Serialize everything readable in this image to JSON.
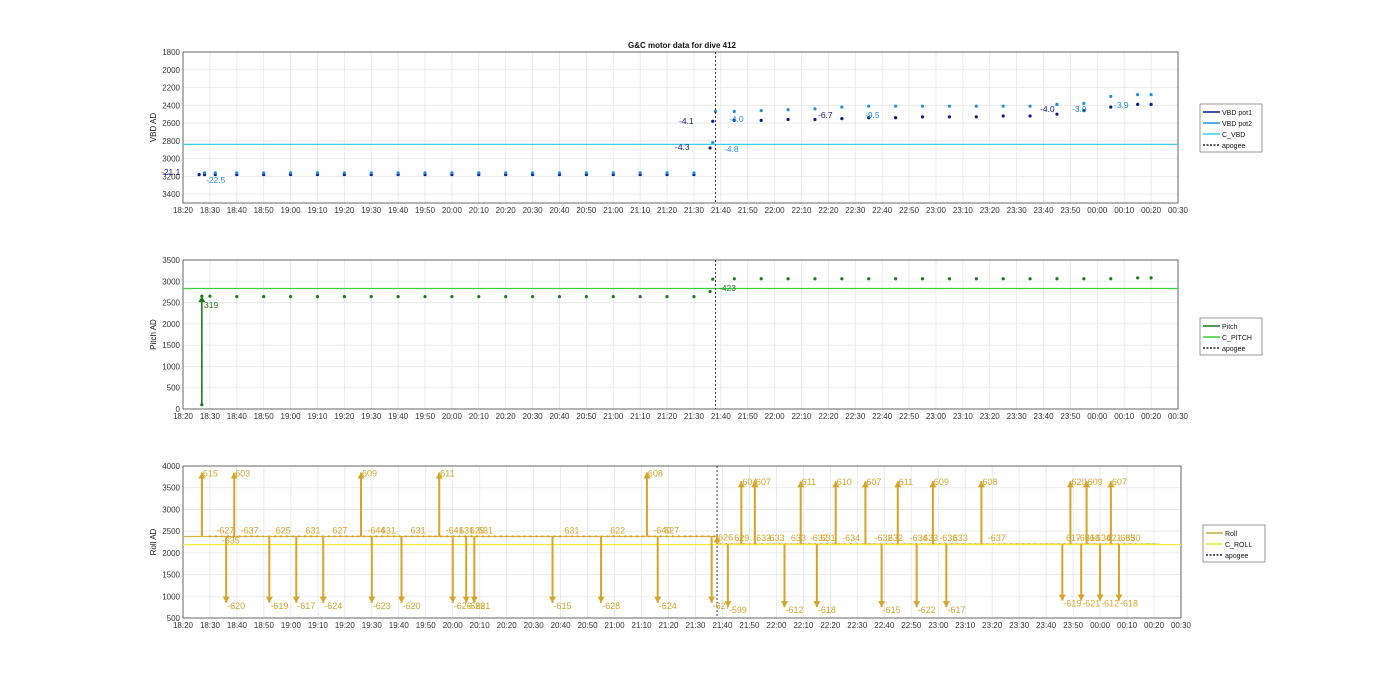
{
  "figure": {
    "title": "G&C motor data for dive 412"
  },
  "time_ticks": [
    "18:20",
    "18:30",
    "18:40",
    "18:50",
    "19:00",
    "19:10",
    "19:20",
    "19:30",
    "19:40",
    "19:50",
    "20:00",
    "20:10",
    "20:20",
    "20:30",
    "20:40",
    "20:50",
    "21:00",
    "21:10",
    "21:20",
    "21:30",
    "21:40",
    "21:50",
    "22:00",
    "22:10",
    "22:20",
    "22:30",
    "22:40",
    "22:50",
    "23:00",
    "23:10",
    "23:20",
    "23:30",
    "23:40",
    "23:50",
    "00:00",
    "00:10",
    "00:20",
    "00:30"
  ],
  "chart_data": [
    {
      "type": "line",
      "ylabel": "VBD AD",
      "ylim": [
        1800,
        3500
      ],
      "y_reversed": true,
      "yticks": [
        "1800",
        "2000",
        "2200",
        "2400",
        "2600",
        "2800",
        "3000",
        "3200",
        "3400"
      ],
      "grid": true,
      "legend_position": "outside-right",
      "series": [
        {
          "name": "VBD pot1",
          "color": "#0a1a8c",
          "x": [
            "18:26",
            "18:28",
            "18:32",
            "18:40",
            "18:50",
            "19:00",
            "19:10",
            "19:20",
            "19:30",
            "19:40",
            "19:50",
            "20:00",
            "20:10",
            "20:20",
            "20:30",
            "20:40",
            "20:50",
            "21:00",
            "21:10",
            "21:20",
            "21:30",
            "21:36",
            "21:37",
            "21:45",
            "21:55",
            "22:05",
            "22:15",
            "22:25",
            "22:35",
            "22:45",
            "22:55",
            "23:05",
            "23:15",
            "23:25",
            "23:35",
            "23:45",
            "23:55",
            "00:05",
            "00:15",
            "00:20"
          ],
          "values": [
            3180,
            3180,
            3180,
            3180,
            3180,
            3180,
            3180,
            3180,
            3180,
            3180,
            3180,
            3180,
            3180,
            3180,
            3180,
            3180,
            3180,
            3180,
            3180,
            3180,
            3180,
            2880,
            2580,
            2570,
            2570,
            2560,
            2560,
            2550,
            2540,
            2540,
            2530,
            2530,
            2530,
            2520,
            2520,
            2500,
            2460,
            2420,
            2390,
            2390
          ]
        },
        {
          "name": "VBD pot2",
          "color": "#1e90e0",
          "x": [
            "18:28",
            "18:32",
            "18:40",
            "18:50",
            "19:00",
            "19:10",
            "19:20",
            "19:30",
            "19:40",
            "19:50",
            "20:00",
            "20:10",
            "20:20",
            "20:30",
            "20:40",
            "20:50",
            "21:00",
            "21:10",
            "21:20",
            "21:30",
            "21:37",
            "21:38",
            "21:45",
            "21:55",
            "22:05",
            "22:15",
            "22:25",
            "22:35",
            "22:45",
            "22:55",
            "23:05",
            "23:15",
            "23:25",
            "23:35",
            "23:45",
            "23:55",
            "00:05",
            "00:15",
            "00:20"
          ],
          "values": [
            3160,
            3160,
            3160,
            3160,
            3160,
            3160,
            3160,
            3160,
            3160,
            3160,
            3160,
            3160,
            3160,
            3160,
            3160,
            3160,
            3160,
            3160,
            3160,
            3160,
            2820,
            2470,
            2470,
            2460,
            2450,
            2440,
            2420,
            2410,
            2410,
            2410,
            2410,
            2410,
            2410,
            2410,
            2390,
            2380,
            2300,
            2280,
            2280
          ]
        },
        {
          "name": "C_VBD",
          "color": "#3ad0e8",
          "x": [
            "18:20",
            "00:30"
          ],
          "values": [
            2840,
            2840
          ]
        },
        {
          "name": "apogee",
          "color": "#222222",
          "dashed": true,
          "x_value": "21:38"
        }
      ],
      "annotations": [
        "-21.1",
        "-22.5",
        "-4.3",
        "-4.8",
        "-4.1",
        "-4.0",
        "-6.7",
        "-9.5",
        "-4.0",
        "-3.9",
        "-3.9"
      ]
    },
    {
      "type": "line",
      "ylabel": "Pitch AD",
      "ylim": [
        0,
        3500
      ],
      "yticks": [
        "0",
        "500",
        "1000",
        "1500",
        "2000",
        "2500",
        "3000",
        "3500"
      ],
      "grid": true,
      "legend_position": "outside-right",
      "series": [
        {
          "name": "Pitch",
          "color": "#1c7a1c",
          "x": [
            "18:27",
            "18:27",
            "18:30",
            "18:40",
            "18:50",
            "19:00",
            "19:10",
            "19:20",
            "19:30",
            "19:40",
            "19:50",
            "20:00",
            "20:10",
            "20:20",
            "20:30",
            "20:40",
            "20:50",
            "21:00",
            "21:10",
            "21:20",
            "21:30",
            "21:36",
            "21:37",
            "21:45",
            "21:55",
            "22:05",
            "22:15",
            "22:25",
            "22:35",
            "22:45",
            "22:55",
            "23:05",
            "23:15",
            "23:25",
            "23:35",
            "23:45",
            "23:55",
            "00:05",
            "00:15",
            "00:20"
          ],
          "values": [
            100,
            2650,
            2650,
            2640,
            2640,
            2640,
            2640,
            2640,
            2640,
            2640,
            2640,
            2640,
            2640,
            2640,
            2640,
            2640,
            2640,
            2640,
            2640,
            2640,
            2640,
            2760,
            3050,
            3060,
            3060,
            3060,
            3060,
            3060,
            3060,
            3060,
            3060,
            3060,
            3060,
            3060,
            3060,
            3060,
            3060,
            3060,
            3080,
            3080
          ]
        },
        {
          "name": "C_PITCH",
          "color": "#3ad03a",
          "x": [
            "18:20",
            "00:30"
          ],
          "values": [
            2830,
            2830
          ]
        },
        {
          "name": "apogee",
          "color": "#222222",
          "dashed": true,
          "x_value": "21:38"
        }
      ],
      "annotations": [
        "319",
        "-423"
      ]
    },
    {
      "type": "line",
      "ylabel": "Roll AD",
      "ylim": [
        500,
        4000
      ],
      "yticks": [
        "500",
        "1000",
        "1500",
        "2000",
        "2500",
        "3000",
        "3500",
        "4000"
      ],
      "grid": true,
      "legend_position": "outside-right",
      "series": [
        {
          "name": "Roll",
          "color": "#d4a52a",
          "x": [
            "18:20",
            "21:38",
            "21:38",
            "00:22"
          ],
          "values": [
            2380,
            2380,
            2200,
            2200
          ]
        },
        {
          "name": "C_ROLL",
          "color": "#f0ea3a",
          "x": [
            "18:20",
            "00:30"
          ],
          "values": [
            2190,
            2190
          ]
        },
        {
          "name": "apogee",
          "color": "#222222",
          "dashed": true,
          "x_value": "21:38"
        }
      ],
      "roll_events": [
        {
          "x": "18:27",
          "y": 3850,
          "label": "615"
        },
        {
          "x": "18:32",
          "y": 2380,
          "label": "-627"
        },
        {
          "x": "18:34",
          "y": 2380,
          "label": "-635"
        },
        {
          "x": "18:36",
          "y": 850,
          "label": "-620"
        },
        {
          "x": "18:39",
          "y": 3850,
          "label": "603"
        },
        {
          "x": "18:41",
          "y": 2380,
          "label": "-637"
        },
        {
          "x": "18:52",
          "y": 850,
          "label": "-619"
        },
        {
          "x": "18:54",
          "y": 2380,
          "label": "625"
        },
        {
          "x": "19:02",
          "y": 850,
          "label": "-617"
        },
        {
          "x": "19:05",
          "y": 2380,
          "label": "631"
        },
        {
          "x": "19:12",
          "y": 850,
          "label": "-624"
        },
        {
          "x": "19:15",
          "y": 2380,
          "label": "627"
        },
        {
          "x": "19:26",
          "y": 3850,
          "label": "609"
        },
        {
          "x": "19:28",
          "y": 2380,
          "label": "-644"
        },
        {
          "x": "19:30",
          "y": 850,
          "label": "-623"
        },
        {
          "x": "19:33",
          "y": 2380,
          "label": "631"
        },
        {
          "x": "19:41",
          "y": 850,
          "label": "-620"
        },
        {
          "x": "19:44",
          "y": 2380,
          "label": "631"
        },
        {
          "x": "19:55",
          "y": 3850,
          "label": "611"
        },
        {
          "x": "19:57",
          "y": 2380,
          "label": "-641"
        },
        {
          "x": "20:00",
          "y": 850,
          "label": "-626"
        },
        {
          "x": "20:02",
          "y": 2380,
          "label": "631"
        },
        {
          "x": "20:05",
          "y": 850,
          "label": "-626"
        },
        {
          "x": "20:06",
          "y": 2380,
          "label": "629"
        },
        {
          "x": "20:08",
          "y": 850,
          "label": "621"
        },
        {
          "x": "20:09",
          "y": 2380,
          "label": "631"
        },
        {
          "x": "20:37",
          "y": 850,
          "label": "-615"
        },
        {
          "x": "20:41",
          "y": 2380,
          "label": "631"
        },
        {
          "x": "20:55",
          "y": 850,
          "label": "-628"
        },
        {
          "x": "20:58",
          "y": 2380,
          "label": "622"
        },
        {
          "x": "21:12",
          "y": 3850,
          "label": "608"
        },
        {
          "x": "21:14",
          "y": 2380,
          "label": "-640"
        },
        {
          "x": "21:16",
          "y": 850,
          "label": "-624"
        },
        {
          "x": "21:18",
          "y": 2380,
          "label": "627"
        },
        {
          "x": "21:36",
          "y": 850,
          "label": "-627"
        },
        {
          "x": "21:38",
          "y": 2380,
          "label": "626"
        },
        {
          "x": "21:42",
          "y": 750,
          "label": "-599"
        },
        {
          "x": "21:44",
          "y": 2200,
          "label": "629"
        },
        {
          "x": "21:47",
          "y": 3650,
          "label": "604"
        },
        {
          "x": "21:51",
          "y": 2200,
          "label": "-633"
        },
        {
          "x": "21:52",
          "y": 3650,
          "label": "607"
        },
        {
          "x": "21:56",
          "y": 2200,
          "label": "-633"
        },
        {
          "x": "22:03",
          "y": 750,
          "label": "-612"
        },
        {
          "x": "22:05",
          "y": 2200,
          "label": "633"
        },
        {
          "x": "22:09",
          "y": 3650,
          "label": "611"
        },
        {
          "x": "22:12",
          "y": 2200,
          "label": "-632"
        },
        {
          "x": "22:15",
          "y": 750,
          "label": "-618"
        },
        {
          "x": "22:16",
          "y": 2200,
          "label": "631"
        },
        {
          "x": "22:22",
          "y": 3650,
          "label": "610"
        },
        {
          "x": "22:24",
          "y": 2200,
          "label": "-634"
        },
        {
          "x": "22:33",
          "y": 3650,
          "label": "607"
        },
        {
          "x": "22:36",
          "y": 2200,
          "label": "-632"
        },
        {
          "x": "22:39",
          "y": 750,
          "label": "-615"
        },
        {
          "x": "22:41",
          "y": 2200,
          "label": "632"
        },
        {
          "x": "22:45",
          "y": 3650,
          "label": "611"
        },
        {
          "x": "22:49",
          "y": 2200,
          "label": "-634"
        },
        {
          "x": "22:52",
          "y": 750,
          "label": "-622"
        },
        {
          "x": "22:54",
          "y": 2200,
          "label": "633"
        },
        {
          "x": "22:58",
          "y": 3650,
          "label": "609"
        },
        {
          "x": "23:00",
          "y": 2200,
          "label": "-636"
        },
        {
          "x": "23:03",
          "y": 750,
          "label": "-617"
        },
        {
          "x": "23:05",
          "y": 2200,
          "label": "633"
        },
        {
          "x": "23:16",
          "y": 3650,
          "label": "608"
        },
        {
          "x": "23:18",
          "y": 2200,
          "label": "-637"
        },
        {
          "x": "23:46",
          "y": 900,
          "label": "-619"
        },
        {
          "x": "23:47",
          "y": 2200,
          "label": "617"
        },
        {
          "x": "23:49",
          "y": 3650,
          "label": "620"
        },
        {
          "x": "23:51",
          "y": 2200,
          "label": "-636"
        },
        {
          "x": "23:53",
          "y": 900,
          "label": "-621"
        },
        {
          "x": "23:54",
          "y": 2200,
          "label": "613"
        },
        {
          "x": "23:55",
          "y": 3650,
          "label": "609"
        },
        {
          "x": "23:57",
          "y": 2200,
          "label": "-634"
        },
        {
          "x": "00:00",
          "y": 900,
          "label": "-612"
        },
        {
          "x": "00:02",
          "y": 2200,
          "label": "621"
        },
        {
          "x": "00:04",
          "y": 3650,
          "label": "607"
        },
        {
          "x": "00:06",
          "y": 2200,
          "label": "-635"
        },
        {
          "x": "00:07",
          "y": 900,
          "label": "-618"
        },
        {
          "x": "00:09",
          "y": 2200,
          "label": "630"
        }
      ]
    }
  ]
}
